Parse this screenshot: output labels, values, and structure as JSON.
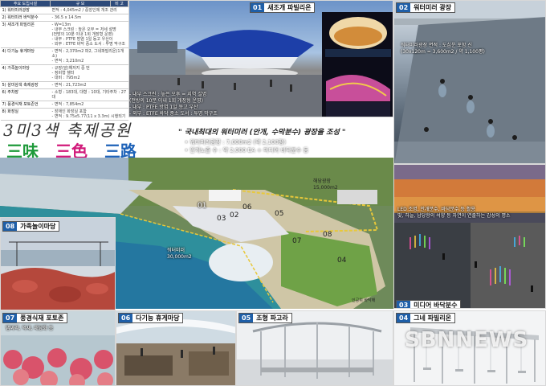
{
  "table": {
    "headers": [
      "주요 도입시설",
      "규 모",
      "비 고"
    ],
    "rows": [
      {
        "key": "1) 워터미러광장",
        "val": "면적 : 4,045m2 / 중앙인제 개조 관리"
      },
      {
        "key": "2) 워터미러 바닥분수",
        "val": "- 36.5 x 14.5m"
      },
      {
        "key": "3) 새조개 파빌리온",
        "val": "- W=13m\n- 내부 스크린 : 높은 오부 = 저세 설명\n(전방의 10분 이내 1회 개장형 운영)\n- 내부 : PTFE 방염 1일 동고 우산이\n- 외부 : ETFE 바닥 중소 도서 : 투명 막구조"
      },
      {
        "key": "4) 다기능 휴게마당",
        "val": "- 면적 : 2,370m2 파2, 그네파빌리온(1개소)\n- 면적 : 3,210m2"
      },
      {
        "key": "4) 가족놀이마당",
        "val": "- 규장(앞)해저지 중 번\n- 정비형 쉘터\n- 대비 : 795m2"
      },
      {
        "key": "5) 삼미삼색 축제광장",
        "val": "- 면적 : 21,723m2"
      },
      {
        "key": "6) 주차장",
        "val": "- 소형 : 183대, 대형 : 10대, 기타주차 : 27대"
      },
      {
        "key": "7) 풍경식재 포토존언",
        "val": "- 면적 : 7,854m2"
      },
      {
        "key": "8) 화장실",
        "val": "- 장애인 화장실 포함\n- 면적 : 9.75x5.77(11 x 3.3m) 시행되기"
      }
    ]
  },
  "title": {
    "main": "3미3색 축제공원",
    "sub": [
      {
        "text": "三味",
        "color": "#1e9a3a"
      },
      {
        "text": "三色",
        "color": "#d1197a"
      },
      {
        "text": "三路",
        "color": "#1e62b8"
      }
    ]
  },
  "slogan": "\" 국내최대의 워터미러 (안개, 수막분수) 광장을 조성 \"",
  "bullets": [
    "• 워터미러광장 : 7,000m2 (약 2,100평)",
    "• 안개노즐 수 : 약 2,000 EA + 미디어 바닥분수 등"
  ],
  "panels": {
    "p01": {
      "num": "01",
      "label": "새조개 파빌리온",
      "lines": [
        "- 내부 스크린 : 높은 오후 = 지역 설명",
        "(전방의 10분 이내 1회 개장형 운영)",
        "- 내부 : PTFE 방염 1일 동고 우산",
        "- 외부 : ETFE 바닥 중소 도서 : 투명 막구조"
      ]
    },
    "p02": {
      "num": "02",
      "label": "워터미러 광장",
      "lines": [
        "워터미러광장 면적 : 도심운 포함 신",
        "(30x120m = 3,600m2 / 약 1,100평)"
      ]
    },
    "p03": {
      "num": "03",
      "label": "미디어 바닥분수",
      "lines": [
        "LED 조명, 안개분수, 바닥분수 등 활용",
        "빛, 하늘, 남당항의 석양 등 자연이 연출하는 감성의 명소"
      ]
    },
    "p04": {
      "num": "04",
      "label": "그네 파빌리온"
    },
    "p05": {
      "num": "05",
      "label": "조형 파고라"
    },
    "p06": {
      "num": "06",
      "label": "다기능 휴게마당"
    },
    "p07": {
      "num": "07",
      "label": "풍경식재 포토존",
      "lines": [
        "댑싸리, 억새, 해당화 등"
      ]
    },
    "p08": {
      "num": "08",
      "label": "가족놀이마당"
    }
  },
  "aerial": {
    "zones": [
      "01",
      "02",
      "03",
      "05",
      "06",
      "07",
      "08",
      "04"
    ],
    "callout_a": "해당광장\n15,000m2",
    "callout_b": "워터미러\n30,000m2",
    "footer": "인공위 바닥해"
  },
  "watermark": "SBNNEWS"
}
